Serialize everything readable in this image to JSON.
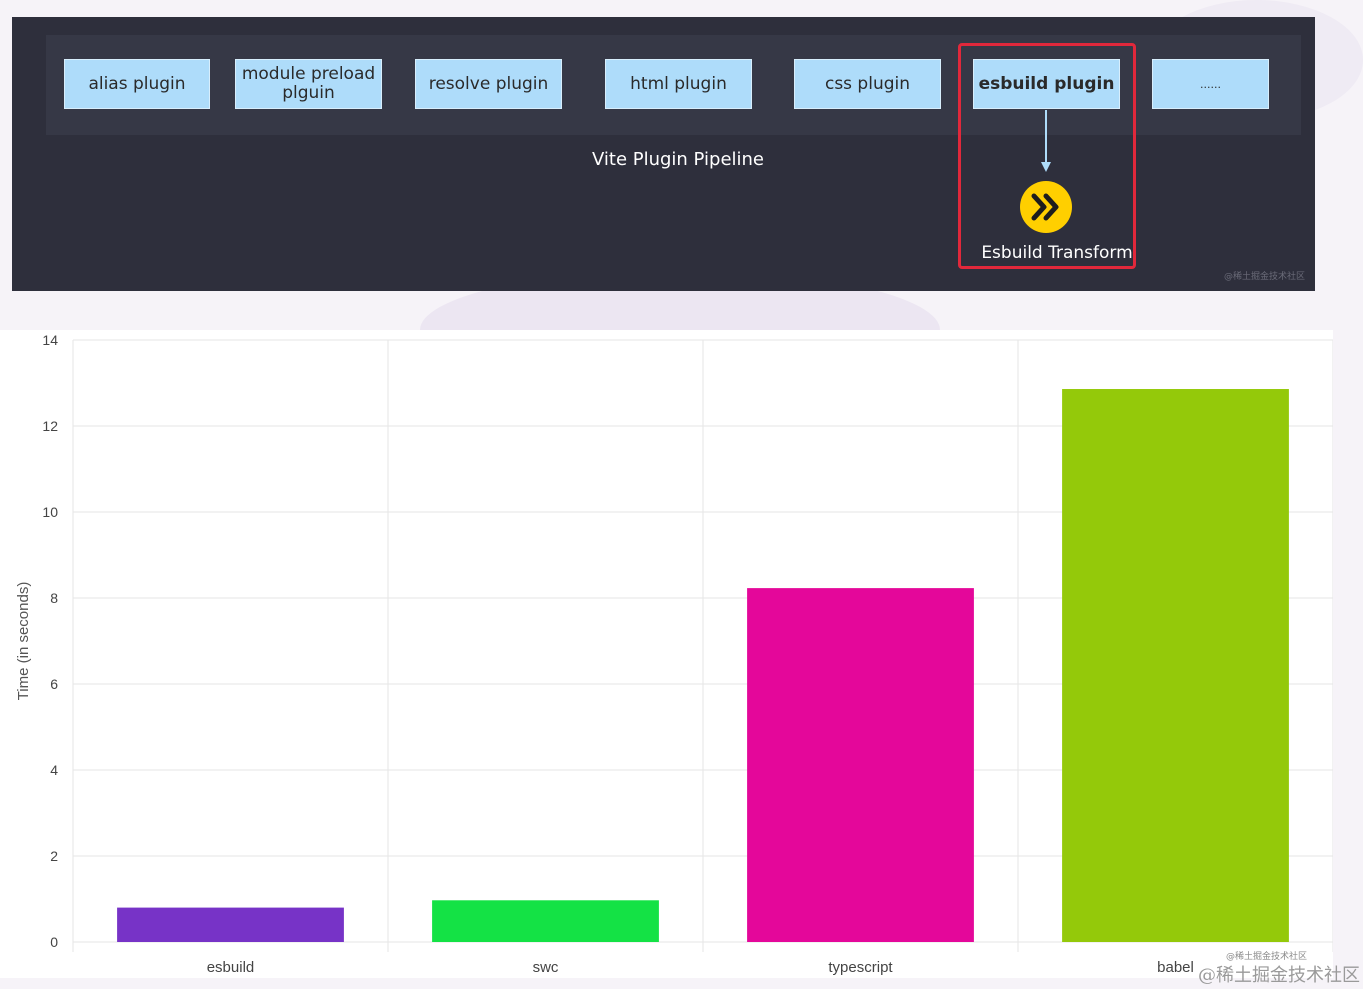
{
  "pipeline": {
    "plugins": [
      {
        "label": "alias plugin"
      },
      {
        "label": "module preload\nplguin"
      },
      {
        "label": "resolve plugin"
      },
      {
        "label": "html plugin"
      },
      {
        "label": "css plugin"
      },
      {
        "label": "esbuild plugin",
        "highlighted": true
      },
      {
        "label": "......"
      }
    ],
    "caption": "Vite Plugin Pipeline",
    "transform_label": "Esbuild Transform",
    "highlight_color": "#e1283b",
    "box_color": "#aedcfa",
    "icon": "esbuild-logo-icon",
    "watermark": "@稀土掘金技术社区"
  },
  "chart_data": {
    "type": "bar",
    "categories": [
      "esbuild",
      "swc",
      "typescript",
      "babel"
    ],
    "values": [
      0.8,
      0.97,
      8.23,
      12.86
    ],
    "colors": [
      "#7733c7",
      "#14e245",
      "#e4079a",
      "#94c90a"
    ],
    "ylabel": "Time (in seconds)",
    "xlabel": "",
    "ylim": [
      0,
      14
    ],
    "yticks": [
      0,
      2,
      4,
      6,
      8,
      10,
      12,
      14
    ],
    "grid": true
  },
  "watermark": {
    "small": "@稀土掘金技术社区",
    "large": "@稀土掘金技术社区"
  }
}
